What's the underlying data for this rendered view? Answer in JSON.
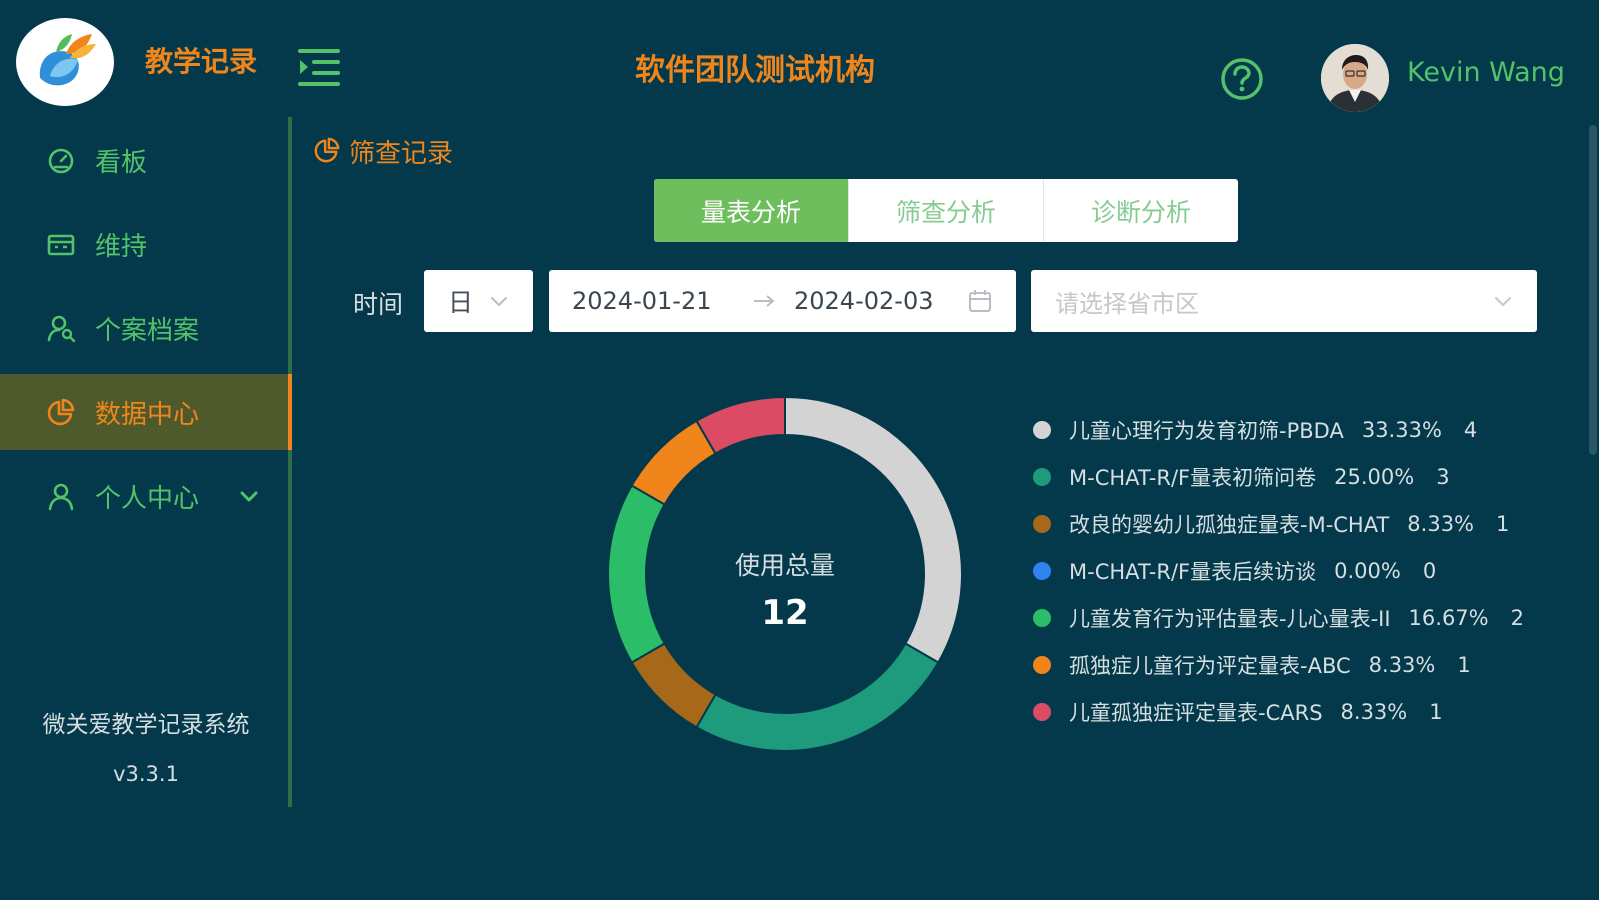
{
  "header": {
    "app_title": "教学记录",
    "org_title": "软件团队测试机构",
    "user_name": "Kevin Wang",
    "icons": {
      "logo": "bird-logo-icon",
      "menu": "menu-fold-icon",
      "help": "help-circle-icon",
      "avatar": "user-avatar"
    }
  },
  "sidebar": {
    "items": [
      {
        "label": "看板",
        "icon": "dashboard-icon",
        "active": false
      },
      {
        "label": "维持",
        "icon": "calendar-icon",
        "active": false
      },
      {
        "label": "个案档案",
        "icon": "user-search-icon",
        "active": false
      },
      {
        "label": "数据中心",
        "icon": "pie-chart-icon",
        "active": true
      },
      {
        "label": "个人中心",
        "icon": "user-icon",
        "active": false,
        "has_submenu": true
      }
    ],
    "system_name": "微关爱教学记录系统",
    "version": "v3.3.1"
  },
  "breadcrumb": {
    "label": "筛查记录",
    "icon": "pie-chart-icon"
  },
  "tabs": [
    {
      "label": "量表分析",
      "active": true
    },
    {
      "label": "筛查分析",
      "active": false
    },
    {
      "label": "诊断分析",
      "active": false
    }
  ],
  "filters": {
    "time_label": "时间",
    "unit_value": "日",
    "date_start": "2024-01-21",
    "date_end": "2024-02-03",
    "region_placeholder": "请选择省市区"
  },
  "chart_data": {
    "type": "pie",
    "center_label": "使用总量",
    "total": "12",
    "slices": [
      {
        "name": "儿童心理行为发育初筛-PBDA",
        "percent": "33.33%",
        "count": "4",
        "value": 4,
        "color": "#d3d3d3"
      },
      {
        "name": "M-CHAT-R/F量表初筛问卷",
        "percent": "25.00%",
        "count": "3",
        "value": 3,
        "color": "#1e9a7c"
      },
      {
        "name": "改良的婴幼儿孤独症量表-M-CHAT",
        "percent": "8.33%",
        "count": "1",
        "value": 1,
        "color": "#a8681a"
      },
      {
        "name": "M-CHAT-R/F量表后续访谈",
        "percent": "0.00%",
        "count": "0",
        "value": 0,
        "color": "#2f82f0"
      },
      {
        "name": "儿童发育行为评估量表-儿心量表-II",
        "percent": "16.67%",
        "count": "2",
        "value": 2,
        "color": "#2bbd68"
      },
      {
        "name": "孤独症儿童行为评定量表-ABC",
        "percent": "8.33%",
        "count": "1",
        "value": 1,
        "color": "#f0861b"
      },
      {
        "name": "儿童孤独症评定量表-CARS",
        "percent": "8.33%",
        "count": "1",
        "value": 1,
        "color": "#db4b63"
      }
    ]
  },
  "colors": {
    "background": "#03394b",
    "accent_orange": "#f0861b",
    "accent_green": "#53c269",
    "tab_active": "#6fbe5d",
    "nav_active_bg": "#4e5a2c"
  }
}
